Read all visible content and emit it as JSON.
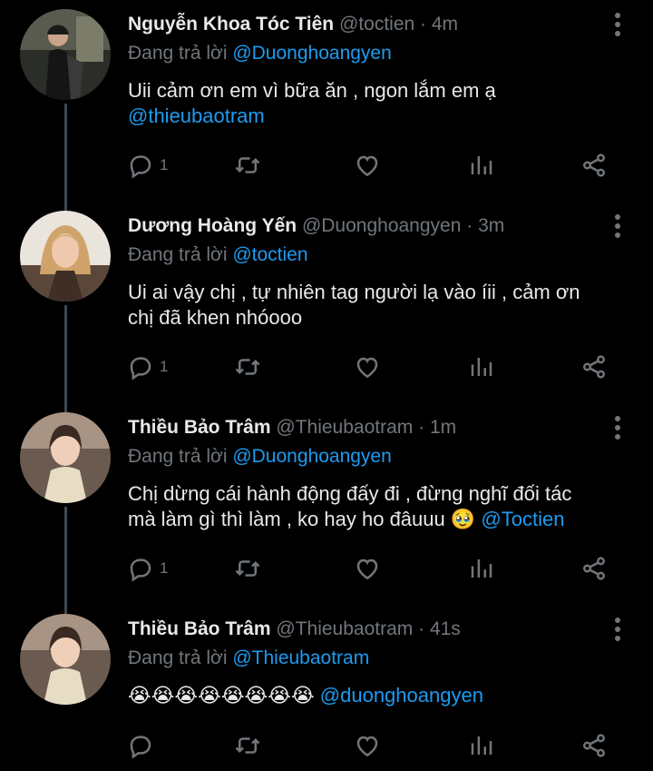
{
  "tweets": [
    {
      "name": "Nguyễn Khoa Tóc Tiên",
      "handle": "@toctien",
      "time": "4m",
      "replying_prefix": "Đang trả lời",
      "replying_to": "@Duonghoangyen",
      "text": "Uii cảm ơn em vì bữa ăn , ngon lắm em ạ",
      "mention": "@thieubaotram",
      "reply_count": "1"
    },
    {
      "name": "Dương Hoàng Yến",
      "handle": "@Duonghoangyen",
      "time": "3m",
      "replying_prefix": "Đang trả lời",
      "replying_to": "@toctien",
      "text_line1": "Ui ai vậy chị , tự nhiên tag người lạ vào íii , cảm ơn",
      "text_line2": "chị đã khen nhóooo",
      "reply_count": "1"
    },
    {
      "name": "Thiều Bảo Trâm",
      "handle": "@Thieubaotram",
      "time": "1m",
      "replying_prefix": "Đang trả lời",
      "replying_to": "@Duonghoangyen",
      "text_line1": "Chị dừng cái hành động đấy đi , đừng nghĩ đối tác",
      "text_line2": "mà làm gì thì làm , ko hay ho đâuuu",
      "emoji": "🥹",
      "mention": "@Toctien",
      "reply_count": "1"
    },
    {
      "name": "Thiều Bảo Trâm",
      "handle": "@Thieubaotram",
      "time": "41s",
      "replying_prefix": "Đang trả lời",
      "replying_to": "@Thieubaotram",
      "emojis": "😭😭😭😭😭😭😭😭",
      "mention": "@duonghoangyen",
      "reply_count": ""
    }
  ],
  "separator": "·",
  "icons": [
    "reply-icon",
    "retweet-icon",
    "like-icon",
    "analytics-icon",
    "share-icon",
    "more-icon"
  ],
  "colors": {
    "background": "#000000",
    "text": "#e7e9ea",
    "muted": "#71767b",
    "link": "#1d9bf0",
    "thread": "#3d4a52"
  }
}
